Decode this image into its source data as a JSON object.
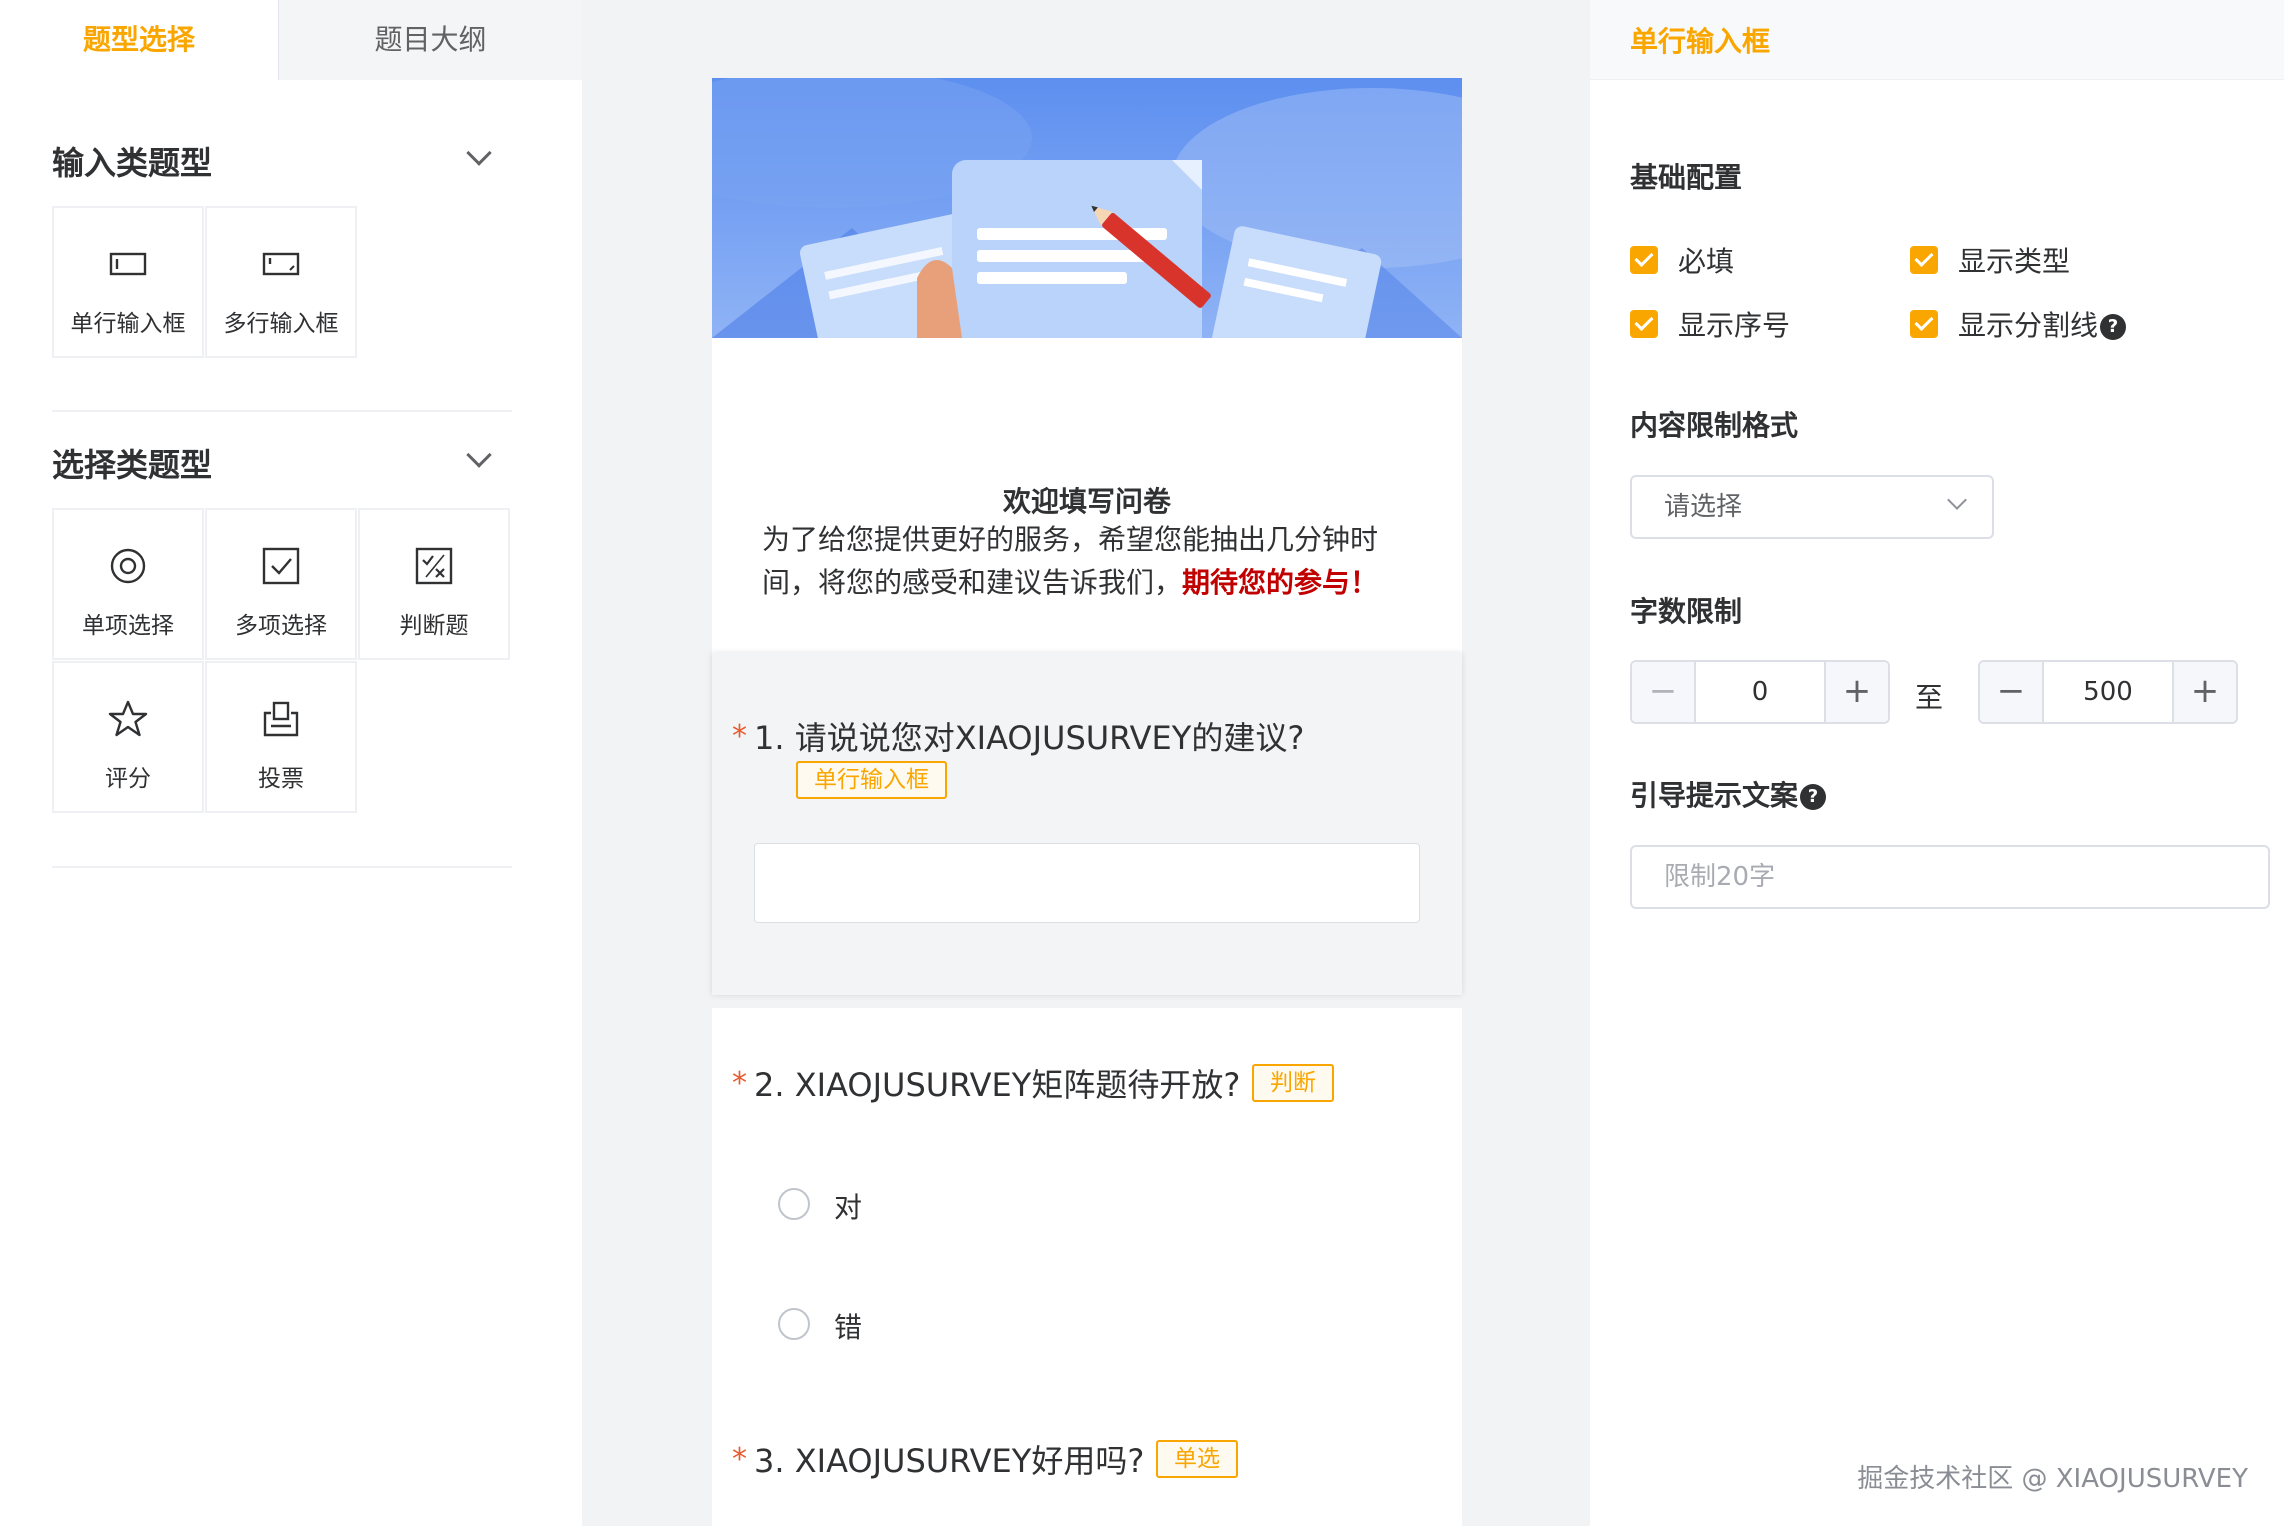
{
  "left_panel": {
    "tabs": [
      {
        "label": "题型选择",
        "active": true
      },
      {
        "label": "题目大纲",
        "active": false
      }
    ],
    "groups": [
      {
        "title": "输入类题型",
        "items": [
          {
            "label": "单行输入框",
            "icon": "single-line-input-icon"
          },
          {
            "label": "多行输入框",
            "icon": "multi-line-input-icon"
          }
        ]
      },
      {
        "title": "选择类题型",
        "items": [
          {
            "label": "单项选择",
            "icon": "radio-circle-icon"
          },
          {
            "label": "多项选择",
            "icon": "checkbox-icon"
          },
          {
            "label": "判断题",
            "icon": "judge-icon"
          },
          {
            "label": "评分",
            "icon": "star-icon"
          },
          {
            "label": "投票",
            "icon": "vote-icon"
          }
        ]
      }
    ]
  },
  "canvas": {
    "welcome_title": "欢迎填写问卷",
    "welcome_desc": "为了给您提供更好的服务，希望您能抽出几分钟时间，将您的感受和建议告诉我们，",
    "welcome_highlight": "期待您的参与！",
    "questions": [
      {
        "required_mark": "*",
        "title": "1. 请说说您对XIAOJUSURVEY的建议?",
        "tag": "单行输入框"
      },
      {
        "required_mark": "*",
        "title": "2. XIAOJUSURVEY矩阵题待开放?",
        "tag": "判断",
        "options": [
          "对",
          "错"
        ]
      },
      {
        "required_mark": "*",
        "title": "3. XIAOJUSURVEY好用吗?",
        "tag": "单选"
      }
    ]
  },
  "right_panel": {
    "header": "单行输入框",
    "basic_config_title": "基础配置",
    "checkboxes": [
      {
        "label": "必填",
        "checked": true
      },
      {
        "label": "显示类型",
        "checked": true
      },
      {
        "label": "显示序号",
        "checked": true
      },
      {
        "label": "显示分割线",
        "checked": true
      }
    ],
    "help_mark": "?",
    "format_title": "内容限制格式",
    "format_placeholder": "请选择",
    "length_title": "字数限制",
    "min_value": "0",
    "max_value": "500",
    "to_label": "至",
    "minus_symbol": "−",
    "plus_symbol": "+",
    "hint_title": "引导提示文案",
    "hint_placeholder": "限制20字"
  },
  "watermark": "掘金技术社区 @ XIAOJUSURVEY",
  "colors": {
    "accent": "#faa600",
    "required": "#e85b2f",
    "highlight": "#c10000",
    "banner": "#5d8ff0"
  }
}
